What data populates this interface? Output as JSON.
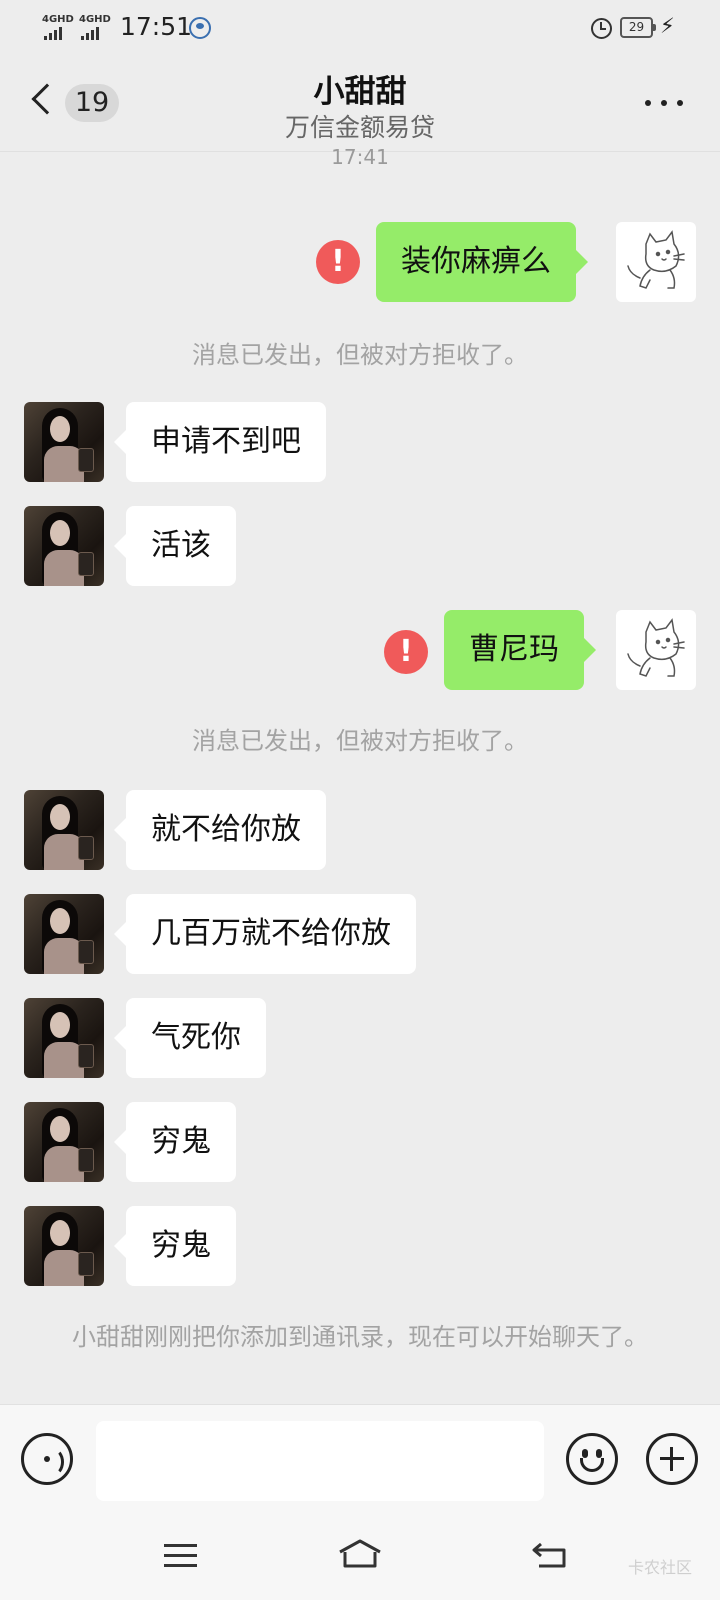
{
  "status_bar": {
    "signal1_label": "4GHD",
    "signal2_label": "4GHD",
    "time": "17:51",
    "battery_level": "29"
  },
  "header": {
    "unread_count": "19",
    "title": "小甜甜",
    "subtitle": "万信金额易贷"
  },
  "messages": {
    "timestamp": "17:41",
    "out1": "装你麻痹么",
    "rejected_note_1": "消息已发出，但被对方拒收了。",
    "in1": "申请不到吧",
    "in2": "活该",
    "out2": "曹尼玛",
    "rejected_note_2": "消息已发出，但被对方拒收了。",
    "in3": "就不给你放",
    "in4": "几百万就不给你放",
    "in5": "气死你",
    "in6": "穷鬼",
    "in7": "穷鬼",
    "contact_note": "小甜甜刚刚把你添加到通讯录，现在可以开始聊天了。"
  },
  "input_bar": {
    "value": "",
    "placeholder": ""
  },
  "watermark": "卡农社区",
  "colors": {
    "background": "#ededed",
    "outgoing_bubble": "#95ec69",
    "incoming_bubble": "#ffffff",
    "error_badge": "#f05a5a"
  },
  "icons": [
    "back-icon",
    "more-icon",
    "error-icon",
    "voice-icon",
    "emoji-icon",
    "plus-icon",
    "menu-icon",
    "home-icon",
    "back-nav-icon",
    "alarm-icon",
    "battery-icon",
    "bolt-icon"
  ]
}
